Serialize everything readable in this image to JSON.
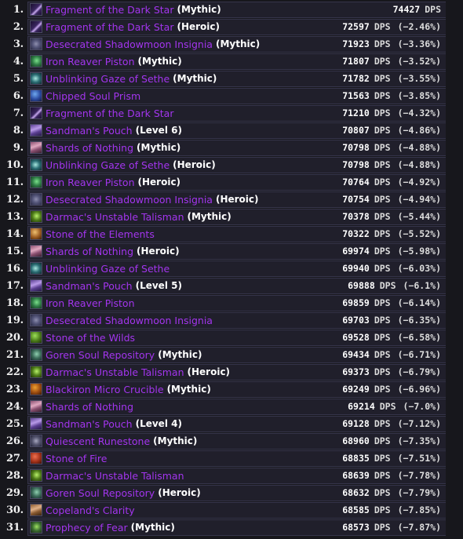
{
  "list": {
    "unit_label": "DPS",
    "name_color": "#a335ee",
    "suffix_color": "#ffffff",
    "row_bg": "#201f2b",
    "row_border": "#35344a",
    "page_bg": "#17171c",
    "rows": [
      {
        "rank": "1.",
        "name": "Fragment of the Dark Star",
        "suffix": "(Mythic)",
        "dps": "74427",
        "delta": "",
        "icon": {
          "a": "#c7a8ee",
          "b": "#3a2660",
          "c": "#1b1030",
          "style": "shard"
        }
      },
      {
        "rank": "2.",
        "name": "Fragment of the Dark Star",
        "suffix": "(Heroic)",
        "dps": "72597",
        "delta": "(−2.46%)",
        "icon": {
          "a": "#c7a8ee",
          "b": "#3a2660",
          "c": "#1b1030",
          "style": "shard"
        }
      },
      {
        "rank": "3.",
        "name": "Desecrated Shadowmoon Insignia",
        "suffix": "(Mythic)",
        "dps": "71923",
        "delta": "(−3.36%)",
        "icon": {
          "a": "#8e8fae",
          "b": "#55567a",
          "c": "#2a2b44",
          "style": "orb"
        }
      },
      {
        "rank": "4.",
        "name": "Iron Reaver Piston",
        "suffix": "(Mythic)",
        "dps": "71807",
        "delta": "(−3.52%)",
        "icon": {
          "a": "#7ae08a",
          "b": "#2e7a45",
          "c": "#16351f",
          "style": "tech"
        }
      },
      {
        "rank": "5.",
        "name": "Unblinking Gaze of Sethe",
        "suffix": "(Mythic)",
        "dps": "71782",
        "delta": "(−3.55%)",
        "icon": {
          "a": "#a8e8e0",
          "b": "#2a6d74",
          "c": "#10282c",
          "style": "eye"
        }
      },
      {
        "rank": "6.",
        "name": "Chipped Soul Prism",
        "suffix": "",
        "dps": "71563",
        "delta": "(−3.85%)",
        "icon": {
          "a": "#6fa8ee",
          "b": "#2b4aa0",
          "c": "#141c3e",
          "style": "prism"
        }
      },
      {
        "rank": "7.",
        "name": "Fragment of the Dark Star",
        "suffix": "",
        "dps": "71210",
        "delta": "(−4.32%)",
        "icon": {
          "a": "#c7a8ee",
          "b": "#3a2660",
          "c": "#1b1030",
          "style": "shard"
        }
      },
      {
        "rank": "8.",
        "name": "Sandman's Pouch",
        "suffix": "(Level 6)",
        "dps": "70807",
        "delta": "(−4.86%)",
        "icon": {
          "a": "#b89ae8",
          "b": "#5b3f92",
          "c": "#261a45",
          "style": "pouch"
        }
      },
      {
        "rank": "9.",
        "name": "Shards of Nothing",
        "suffix": "(Mythic)",
        "dps": "70798",
        "delta": "(−4.88%)",
        "icon": {
          "a": "#e0a8c0",
          "b": "#8a4f70",
          "c": "#3a2030",
          "style": "shards"
        }
      },
      {
        "rank": "10.",
        "name": "Unblinking Gaze of Sethe",
        "suffix": "(Heroic)",
        "dps": "70798",
        "delta": "(−4.88%)",
        "icon": {
          "a": "#a8e8e0",
          "b": "#2a6d74",
          "c": "#10282c",
          "style": "eye"
        }
      },
      {
        "rank": "11.",
        "name": "Iron Reaver Piston",
        "suffix": "(Heroic)",
        "dps": "70764",
        "delta": "(−4.92%)",
        "icon": {
          "a": "#7ae08a",
          "b": "#2e7a45",
          "c": "#16351f",
          "style": "tech"
        }
      },
      {
        "rank": "12.",
        "name": "Desecrated Shadowmoon Insignia",
        "suffix": "(Heroic)",
        "dps": "70754",
        "delta": "(−4.94%)",
        "icon": {
          "a": "#8e8fae",
          "b": "#55567a",
          "c": "#2a2b44",
          "style": "orb"
        }
      },
      {
        "rank": "13.",
        "name": "Darmac's Unstable Talisman",
        "suffix": "(Mythic)",
        "dps": "70378",
        "delta": "(−5.44%)",
        "icon": {
          "a": "#b8f06a",
          "b": "#4d7a18",
          "c": "#1e3008",
          "style": "talisman"
        }
      },
      {
        "rank": "14.",
        "name": "Stone of the Elements",
        "suffix": "",
        "dps": "70322",
        "delta": "(−5.52%)",
        "icon": {
          "a": "#f0c070",
          "b": "#9a5a20",
          "c": "#3a2008",
          "style": "stone"
        }
      },
      {
        "rank": "15.",
        "name": "Shards of Nothing",
        "suffix": "(Heroic)",
        "dps": "69974",
        "delta": "(−5.98%)",
        "icon": {
          "a": "#e0a8c0",
          "b": "#8a4f70",
          "c": "#3a2030",
          "style": "shards"
        }
      },
      {
        "rank": "16.",
        "name": "Unblinking Gaze of Sethe",
        "suffix": "",
        "dps": "69940",
        "delta": "(−6.03%)",
        "icon": {
          "a": "#a8e8e0",
          "b": "#2a6d74",
          "c": "#10282c",
          "style": "eye"
        }
      },
      {
        "rank": "17.",
        "name": "Sandman's Pouch",
        "suffix": "(Level 5)",
        "dps": "69888",
        "delta": "(−6.1%)",
        "icon": {
          "a": "#b89ae8",
          "b": "#5b3f92",
          "c": "#261a45",
          "style": "pouch"
        }
      },
      {
        "rank": "18.",
        "name": "Iron Reaver Piston",
        "suffix": "",
        "dps": "69859",
        "delta": "(−6.14%)",
        "icon": {
          "a": "#7ae08a",
          "b": "#2e7a45",
          "c": "#16351f",
          "style": "tech"
        }
      },
      {
        "rank": "19.",
        "name": "Desecrated Shadowmoon Insignia",
        "suffix": "",
        "dps": "69703",
        "delta": "(−6.35%)",
        "icon": {
          "a": "#8e8fae",
          "b": "#55567a",
          "c": "#2a2b44",
          "style": "orb"
        }
      },
      {
        "rank": "20.",
        "name": "Stone of the Wilds",
        "suffix": "",
        "dps": "69528",
        "delta": "(−6.58%)",
        "icon": {
          "a": "#9ce05a",
          "b": "#4a7a18",
          "c": "#1c3008",
          "style": "stone"
        }
      },
      {
        "rank": "21.",
        "name": "Goren Soul Repository",
        "suffix": "(Mythic)",
        "dps": "69434",
        "delta": "(−6.71%)",
        "icon": {
          "a": "#8fd0b0",
          "b": "#3a6a58",
          "c": "#16282a",
          "style": "repo"
        }
      },
      {
        "rank": "22.",
        "name": "Darmac's Unstable Talisman",
        "suffix": "(Heroic)",
        "dps": "69373",
        "delta": "(−6.79%)",
        "icon": {
          "a": "#b8f06a",
          "b": "#4d7a18",
          "c": "#1e3008",
          "style": "talisman"
        }
      },
      {
        "rank": "23.",
        "name": "Blackiron Micro Crucible",
        "suffix": "(Mythic)",
        "dps": "69249",
        "delta": "(−6.96%)",
        "icon": {
          "a": "#f0a030",
          "b": "#9a4a10",
          "c": "#3a1a04",
          "style": "crucible"
        }
      },
      {
        "rank": "24.",
        "name": "Shards of Nothing",
        "suffix": "",
        "dps": "69214",
        "delta": "(−7.0%)",
        "icon": {
          "a": "#e0a8c0",
          "b": "#8a4f70",
          "c": "#3a2030",
          "style": "shards"
        }
      },
      {
        "rank": "25.",
        "name": "Sandman's Pouch",
        "suffix": "(Level 4)",
        "dps": "69128",
        "delta": "(−7.12%)",
        "icon": {
          "a": "#b89ae8",
          "b": "#5b3f92",
          "c": "#261a45",
          "style": "pouch"
        }
      },
      {
        "rank": "26.",
        "name": "Quiescent Runestone",
        "suffix": "(Mythic)",
        "dps": "68960",
        "delta": "(−7.35%)",
        "icon": {
          "a": "#a8a8c0",
          "b": "#5a5a74",
          "c": "#24243a",
          "style": "rune"
        }
      },
      {
        "rank": "27.",
        "name": "Stone of Fire",
        "suffix": "",
        "dps": "68835",
        "delta": "(−7.51%)",
        "icon": {
          "a": "#f07050",
          "b": "#a03018",
          "c": "#3a1008",
          "style": "stone"
        }
      },
      {
        "rank": "28.",
        "name": "Darmac's Unstable Talisman",
        "suffix": "",
        "dps": "68639",
        "delta": "(−7.78%)",
        "icon": {
          "a": "#b8f06a",
          "b": "#4d7a18",
          "c": "#1e3008",
          "style": "talisman"
        }
      },
      {
        "rank": "29.",
        "name": "Goren Soul Repository",
        "suffix": "(Heroic)",
        "dps": "68632",
        "delta": "(−7.79%)",
        "icon": {
          "a": "#8fd0b0",
          "b": "#3a6a58",
          "c": "#16282a",
          "style": "repo"
        }
      },
      {
        "rank": "30.",
        "name": "Copeland's Clarity",
        "suffix": "",
        "dps": "68585",
        "delta": "(−7.85%)",
        "icon": {
          "a": "#e0b088",
          "b": "#8a5a30",
          "c": "#3a2410",
          "style": "face"
        }
      },
      {
        "rank": "31.",
        "name": "Prophecy of Fear",
        "suffix": "(Mythic)",
        "dps": "68573",
        "delta": "(−7.87%)",
        "icon": {
          "a": "#9ce060",
          "b": "#3a6a30",
          "c": "#182a12",
          "style": "prophecy"
        }
      }
    ]
  }
}
